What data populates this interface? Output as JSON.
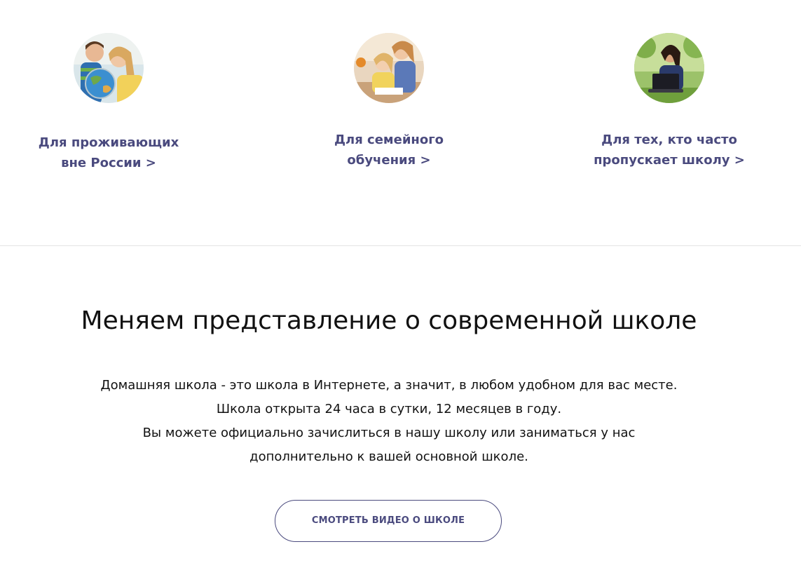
{
  "audience_cards": [
    {
      "line1": "Для проживающих",
      "line2": "вне России >",
      "photo_icon": "children-with-globe-photo"
    },
    {
      "line1": "Для семейного",
      "line2": "обучения >",
      "photo_icon": "mother-and-daughter-studying-photo"
    },
    {
      "line1": "Для тех, кто часто",
      "line2": "пропускает школу >",
      "photo_icon": "girl-with-laptop-outdoors-photo"
    }
  ],
  "about": {
    "headline": "Меняем представление о современной школе",
    "paragraph_lines": [
      "Домашняя школа - это школа в Интернете, а значит, в любом удобном для вас месте.",
      "Школа открыта 24 часа в сутки, 12 месяцев в году.",
      "Вы можете официально зачислиться в нашу школу или заниматься у нас",
      "дополнительно к вашей основной школе."
    ],
    "video_button_label": "СМОТРЕТЬ ВИДЕО О ШКОЛЕ"
  },
  "colors": {
    "accent": "#4a4a7e",
    "text": "#111111",
    "divider": "#e3e3e3",
    "background": "#ffffff"
  }
}
